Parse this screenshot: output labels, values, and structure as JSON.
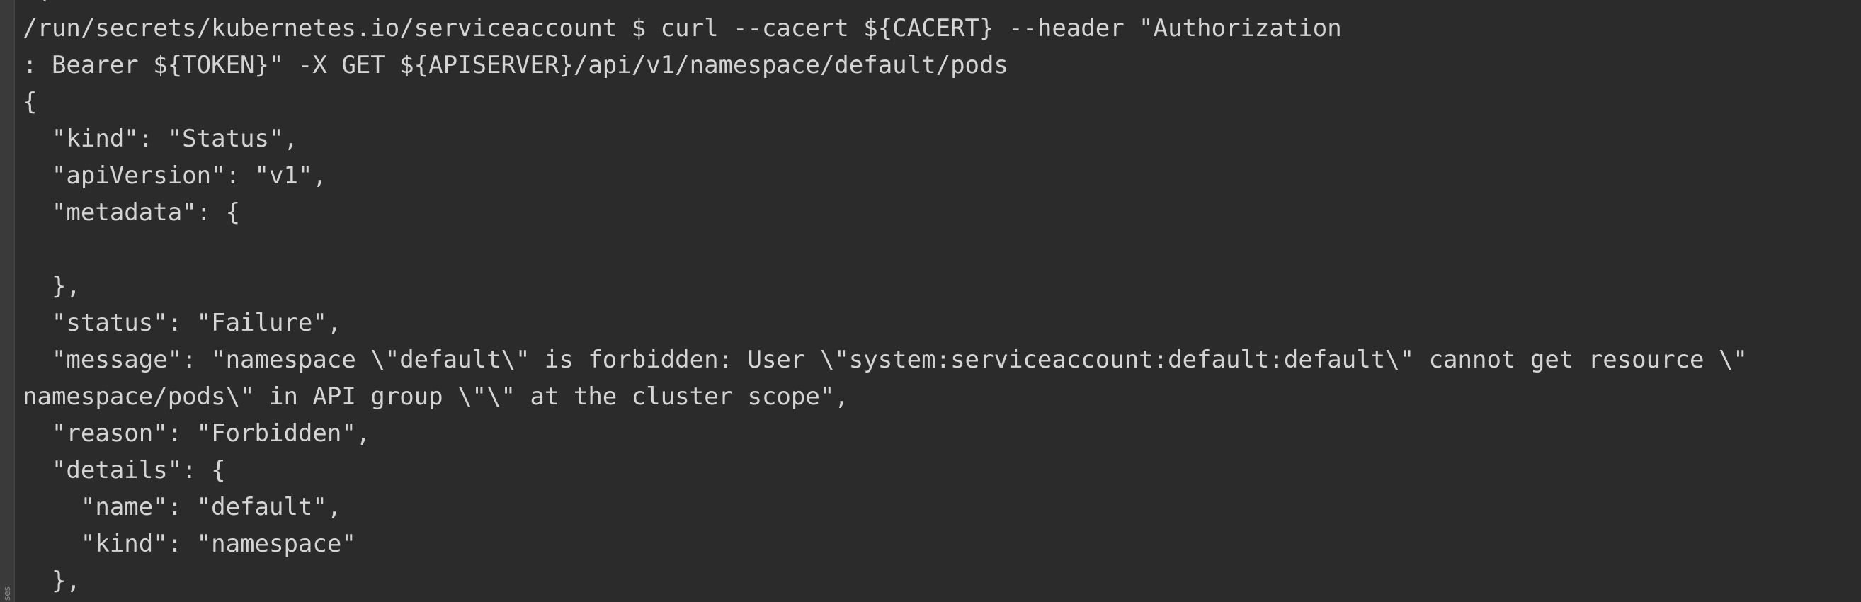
{
  "terminal": {
    "gutter_label": "ses",
    "lines": [
      "/run/secrets/kubernetes.io/serviceaccount $ curl --cacert ${CACERT} --header \"Authorization",
      ": Bearer ${TOKEN}\" -X GET ${APISERVER}/api/v1/namespace/default/pods",
      "{",
      "  \"kind\": \"Status\",",
      "  \"apiVersion\": \"v1\",",
      "  \"metadata\": {",
      "",
      "  },",
      "  \"status\": \"Failure\",",
      "  \"message\": \"namespace \\\"default\\\" is forbidden: User \\\"system:serviceaccount:default:default\\\" cannot get resource \\\"",
      "namespace/pods\\\" in API group \\\"\\\" at the cluster scope\",",
      "  \"reason\": \"Forbidden\",",
      "  \"details\": {",
      "    \"name\": \"default\",",
      "    \"kind\": \"namespace\"",
      "  },"
    ]
  },
  "colors": {
    "background": "#2b2b2b",
    "text": "#d4d4d4",
    "gutter": "#3a3a3a"
  }
}
